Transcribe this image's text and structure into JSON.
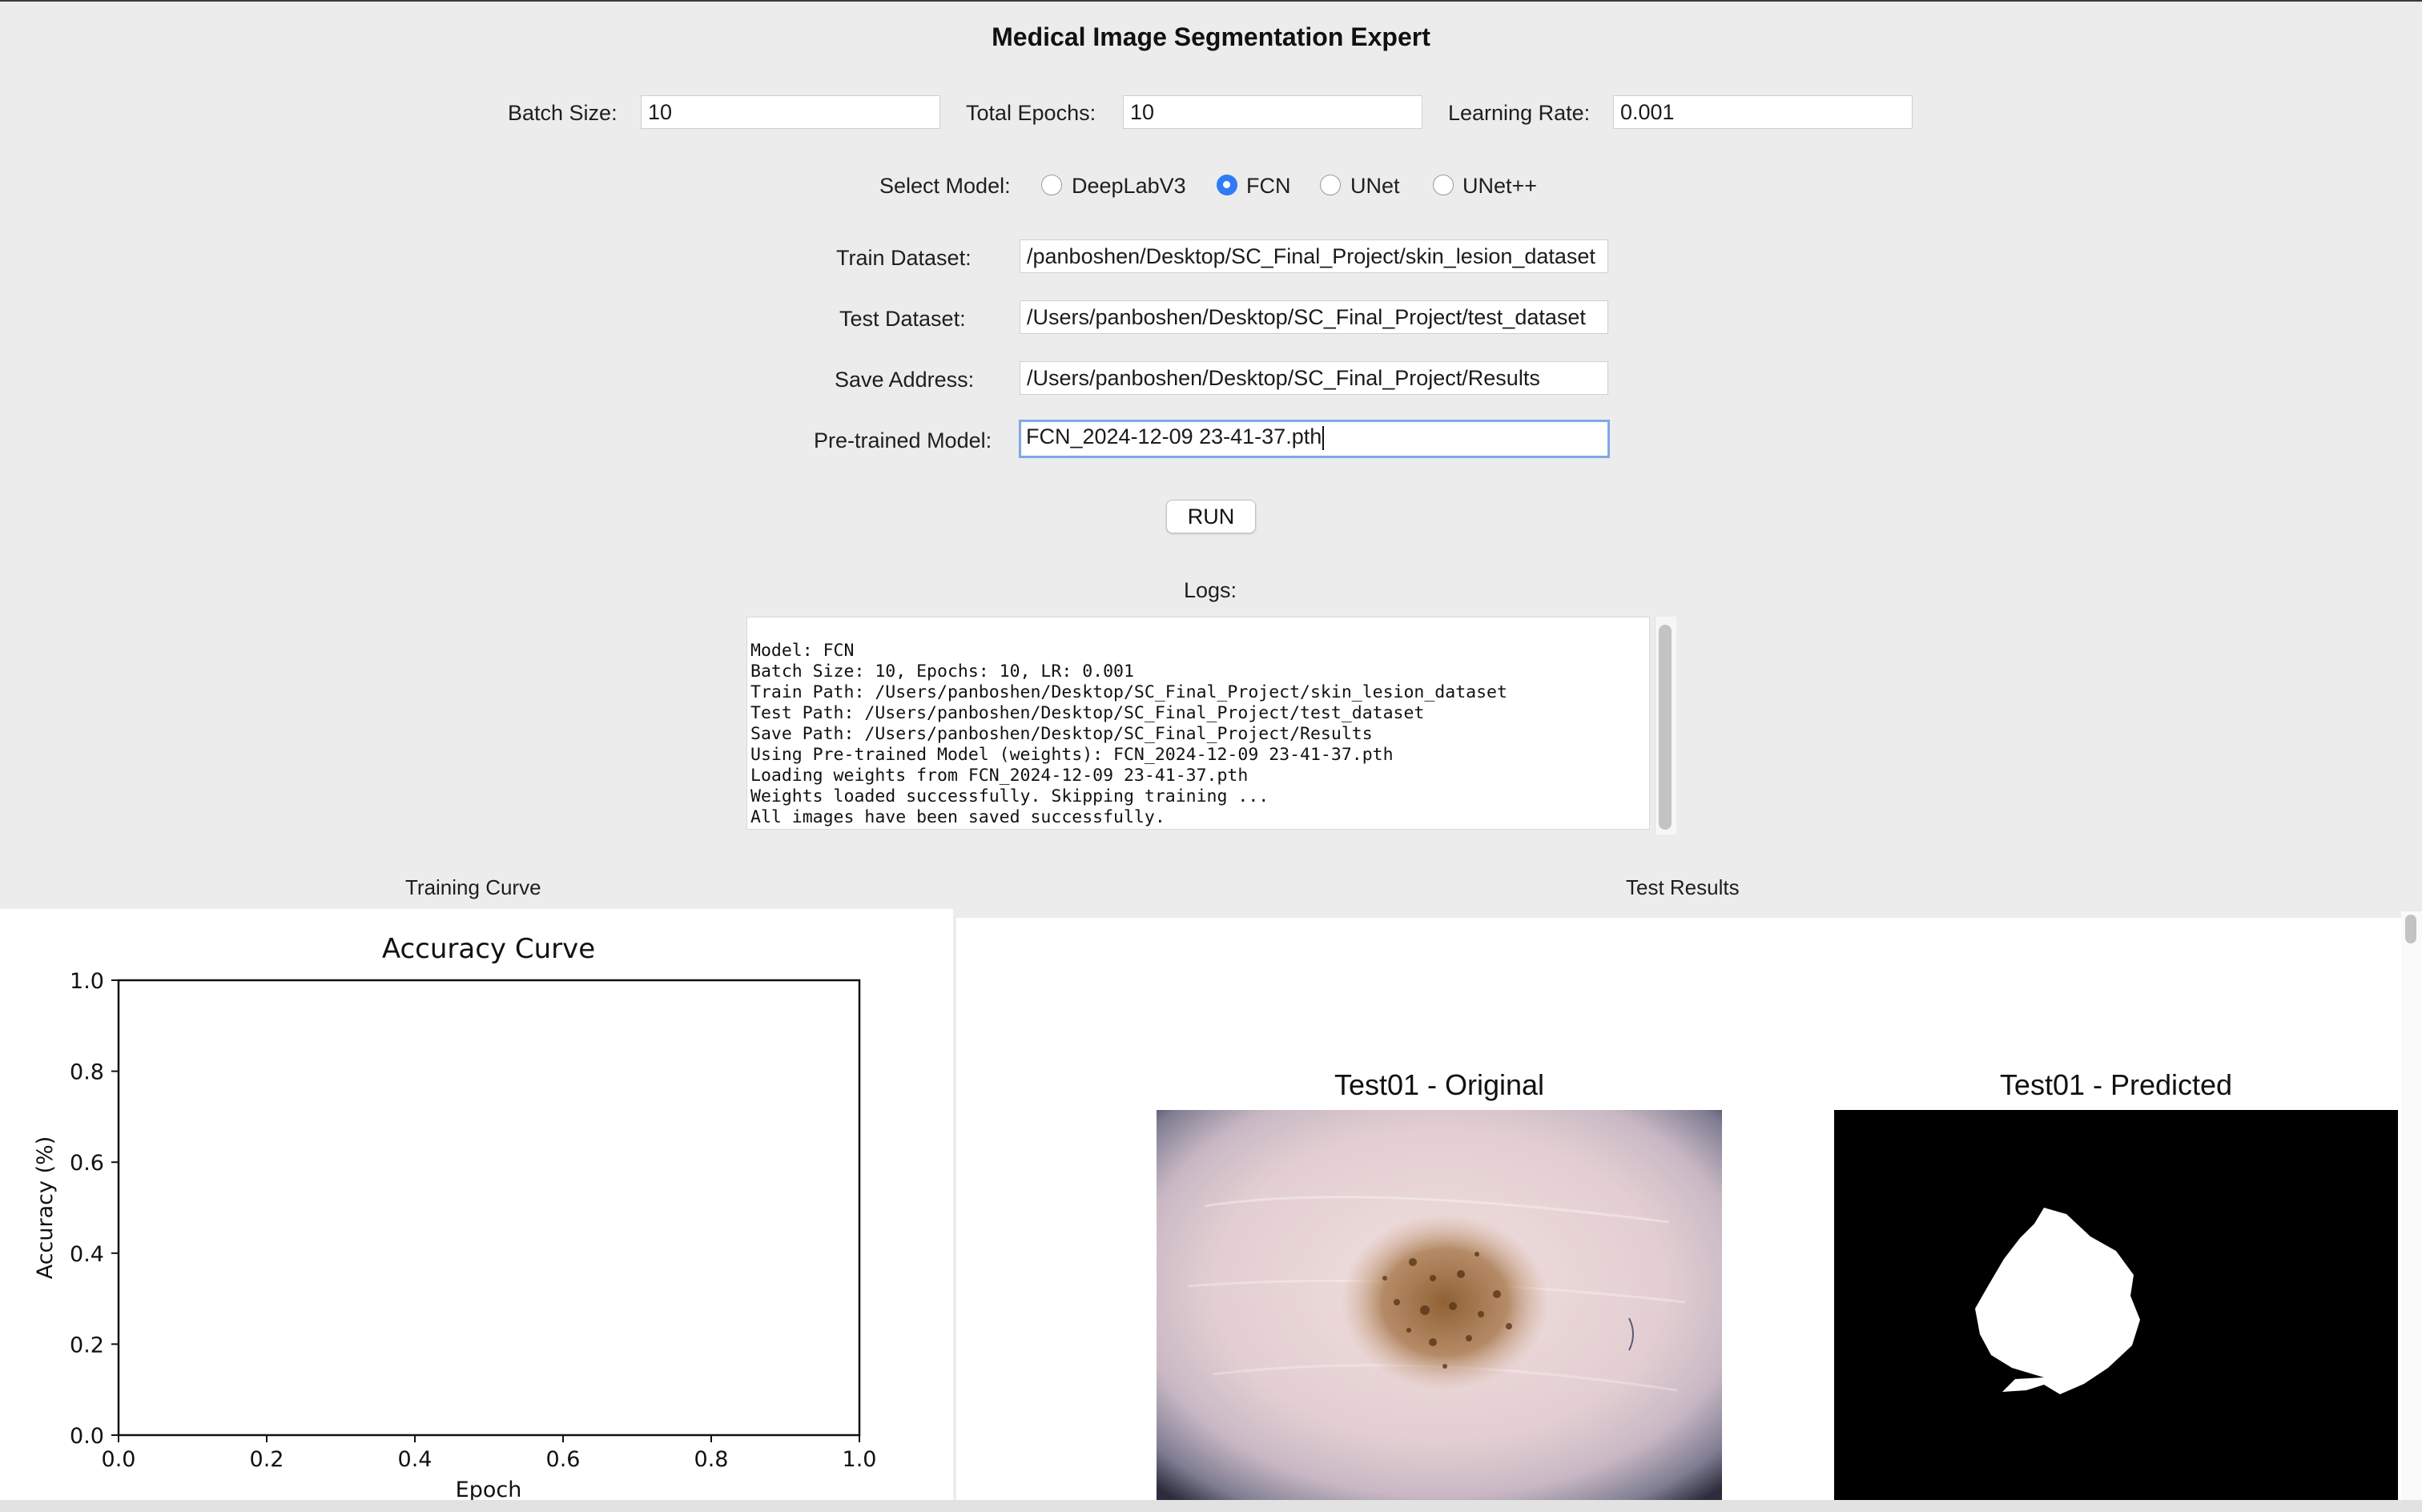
{
  "window_title": "Medical Image Segmentation Expert",
  "params": {
    "batch_size_label": "Batch Size:",
    "batch_size_value": "10",
    "epochs_label": "Total Epochs:",
    "epochs_value": "10",
    "lr_label": "Learning Rate:",
    "lr_value": "0.001"
  },
  "model_select": {
    "label": "Select Model:",
    "options": [
      "DeepLabV3",
      "FCN",
      "UNet",
      "UNet++"
    ],
    "selected": "FCN"
  },
  "paths": {
    "train_label": "Train Dataset:",
    "train_value": "/panboshen/Desktop/SC_Final_Project/skin_lesion_dataset",
    "test_label": "Test Dataset:",
    "test_value": "/Users/panboshen/Desktop/SC_Final_Project/test_dataset",
    "save_label": "Save Address:",
    "save_value": "/Users/panboshen/Desktop/SC_Final_Project/Results",
    "pretrained_label": "Pre-trained Model:",
    "pretrained_value": "FCN_2024-12-09 23-41-37.pth"
  },
  "run_label": "RUN",
  "logs": {
    "label": "Logs:",
    "lines": [
      "Model: FCN",
      "Batch Size: 10, Epochs: 10, LR: 0.001",
      "Train Path: /Users/panboshen/Desktop/SC_Final_Project/skin_lesion_dataset",
      "Test Path: /Users/panboshen/Desktop/SC_Final_Project/test_dataset",
      "Save Path: /Users/panboshen/Desktop/SC_Final_Project/Results",
      "Using Pre-trained Model (weights): FCN_2024-12-09 23-41-37.pth",
      "Loading weights from FCN_2024-12-09 23-41-37.pth",
      "Weights loaded successfully. Skipping training ...",
      "All images have been saved successfully."
    ]
  },
  "training_curve": {
    "section_label": "Training Curve"
  },
  "chart_data": {
    "type": "line",
    "title": "Accuracy Curve",
    "xlabel": "Epoch",
    "ylabel": "Accuracy (%)",
    "xlim": [
      0.0,
      1.0
    ],
    "ylim": [
      0.0,
      1.0
    ],
    "x_ticks": [
      "0.0",
      "0.2",
      "0.4",
      "0.6",
      "0.8",
      "1.0"
    ],
    "y_ticks": [
      "0.0",
      "0.2",
      "0.4",
      "0.6",
      "0.8",
      "1.0"
    ],
    "series": [],
    "grid": false
  },
  "test_results": {
    "section_label": "Test Results",
    "original_title": "Test01 - Original",
    "predicted_title": "Test01 - Predicted"
  },
  "colors": {
    "accent": "#2f7cf6",
    "focus_ring": "#7fa8e6",
    "background": "#ececec"
  }
}
